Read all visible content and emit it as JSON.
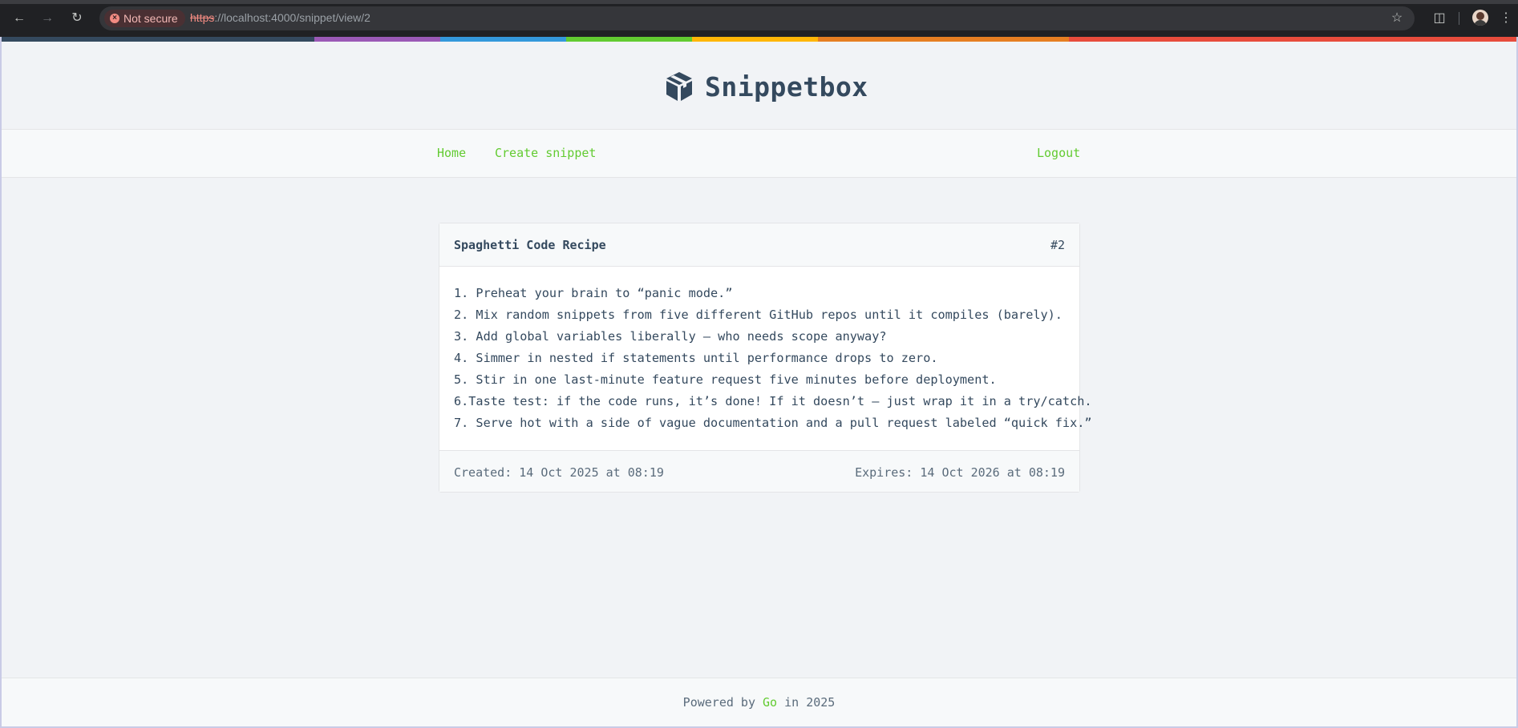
{
  "browser": {
    "security_label": "Not secure",
    "url_scheme": "https",
    "url_rest": "://localhost:4000/snippet/view/2"
  },
  "header": {
    "brand": "Snippetbox"
  },
  "nav": {
    "home": "Home",
    "create": "Create snippet",
    "logout": "Logout"
  },
  "snippet": {
    "title": "Spaghetti Code Recipe",
    "id": "#2",
    "lines": [
      "1. Preheat your brain to “panic mode.”",
      "2. Mix random snippets from five different GitHub repos until it compiles (barely).",
      "3. Add global variables liberally — who needs scope anyway?",
      "4. Simmer in nested if statements until performance drops to zero.",
      "5. Stir in one last-minute feature request five minutes before deployment.",
      "6.Taste test: if the code runs, it’s done! If it doesn’t — just wrap it in a try/catch.",
      "7. Serve hot with a side of vague documentation and a pull request labeled “quick fix.”"
    ],
    "created": "Created: 14 Oct 2025 at 08:19",
    "expires": "Expires: 14 Oct 2026 at 08:19"
  },
  "footer": {
    "prefix": "Powered by ",
    "link": "Go",
    "suffix": " in 2025"
  },
  "colors": {
    "accent": "#62cb31",
    "text": "#34495e",
    "stripe": [
      "#34495e",
      "#9b59b6",
      "#3498db",
      "#62cb31",
      "#ffb606",
      "#e67e22",
      "#e74c3c"
    ]
  }
}
